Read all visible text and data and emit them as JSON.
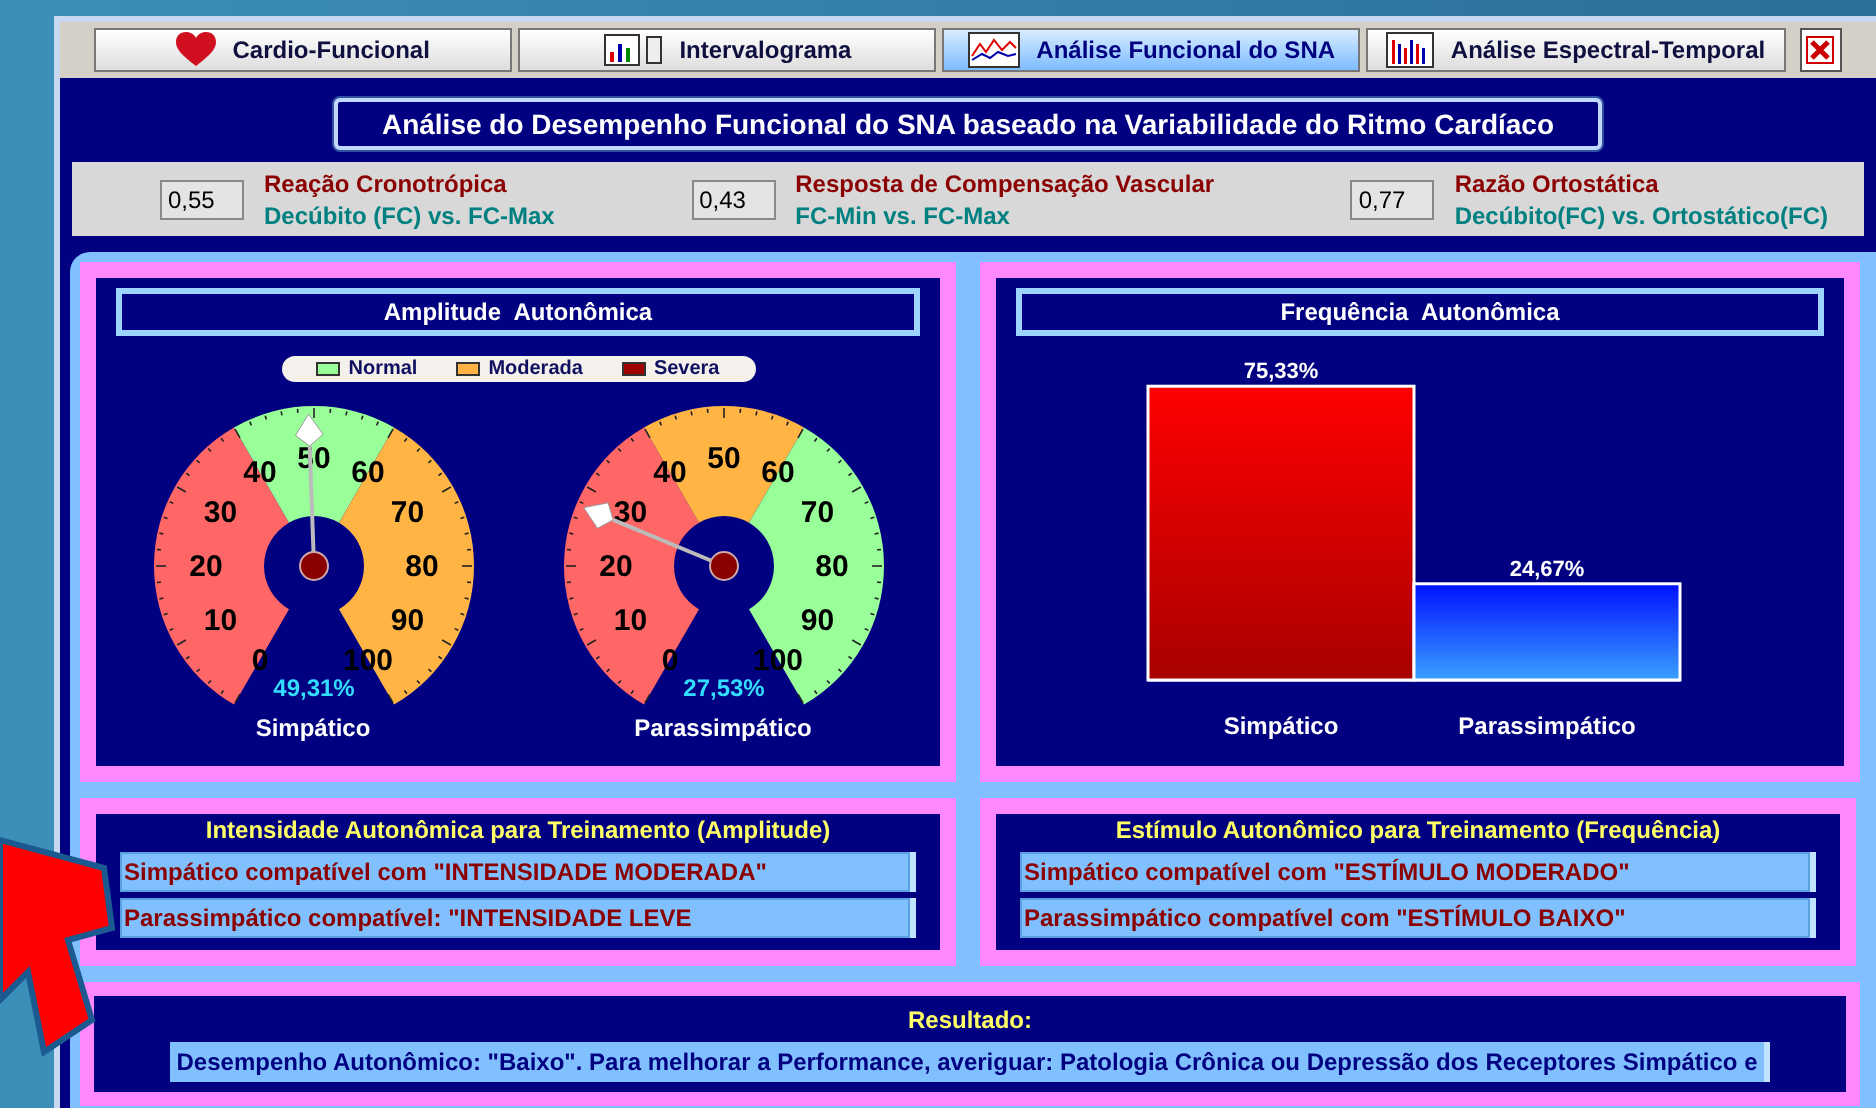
{
  "tabs": [
    {
      "label": "Cardio-Funcional",
      "kind": "heart",
      "selected": false
    },
    {
      "label": "Intervalograma",
      "kind": "chartdoc",
      "selected": false
    },
    {
      "label": "Análise Funcional do SNA",
      "kind": "spectrum",
      "selected": true
    },
    {
      "label": "Análise Espectral-Temporal",
      "kind": "bars",
      "selected": false
    }
  ],
  "page_title": "Análise do Desempenho Funcional do SNA baseado na Variabilidade do Ritmo Cardíaco",
  "indices": [
    {
      "value": "0,55",
      "title": "Reação Cronotrópica",
      "subtitle": "Decúbito (FC) vs. FC-Max"
    },
    {
      "value": "0,43",
      "title": "Resposta de Compensação Vascular",
      "subtitle": "FC-Min vs. FC-Max"
    },
    {
      "value": "0,77",
      "title": "Razão Ortostática",
      "subtitle": "Decúbito(FC) vs. Ortostático(FC)"
    }
  ],
  "amplitude": {
    "title": "Amplitude  Autonômica",
    "legend": [
      {
        "label": "Normal",
        "color": "#99ff99"
      },
      {
        "label": "Moderada",
        "color": "#ffb347"
      },
      {
        "label": "Severa",
        "color": "#a00000"
      }
    ],
    "gauges": [
      {
        "name": "Simpático",
        "reading": "49,31%",
        "level": 0.4931,
        "zones": [
          {
            "kind": "severa"
          },
          {
            "kind": "normal"
          },
          {
            "kind": "moderada"
          }
        ],
        "scale": [
          "50",
          "40",
          "60",
          "30",
          "70",
          "20",
          "80",
          "10",
          "90",
          "0",
          "100"
        ]
      },
      {
        "name": "Parassimpático",
        "reading": "27,53%",
        "level": 0.2753,
        "zones": [
          {
            "kind": "severa"
          },
          {
            "kind": "moderada"
          },
          {
            "kind": "normal"
          }
        ],
        "scale": [
          "50",
          "40",
          "60",
          "30",
          "70",
          "20",
          "80",
          "10",
          "90",
          "0",
          "100"
        ]
      }
    ]
  },
  "frequencia": {
    "title": "Frequência  Autonômica",
    "chart_data": {
      "type": "bar",
      "categories": [
        "Simpático",
        "Parassimpático"
      ],
      "values": [
        75.33,
        24.67
      ],
      "value_labels": [
        "75,33%",
        "24,67%"
      ]
    }
  },
  "training": [
    {
      "title": "Intensidade Autonômica para Treinamento (Amplitude)",
      "lines": [
        "Simpático compatível com \"INTENSIDADE MODERADA\"",
        "Parassimpático compatível: \"INTENSIDADE LEVE"
      ]
    },
    {
      "title": "Estímulo Autonômico para Treinamento (Frequência)",
      "lines": [
        "Simpático compatível com \"ESTÍMULO MODERADO\"",
        "Parassimpático compatível com \"ESTÍMULO BAIXO\""
      ]
    }
  ],
  "result": {
    "title": "Resultado:",
    "text": "Desempenho Autonômico: \"Baixo\". Para melhorar a Performance, averiguar: Patologia Crônica ou Depressão dos Receptores Simpático e"
  }
}
